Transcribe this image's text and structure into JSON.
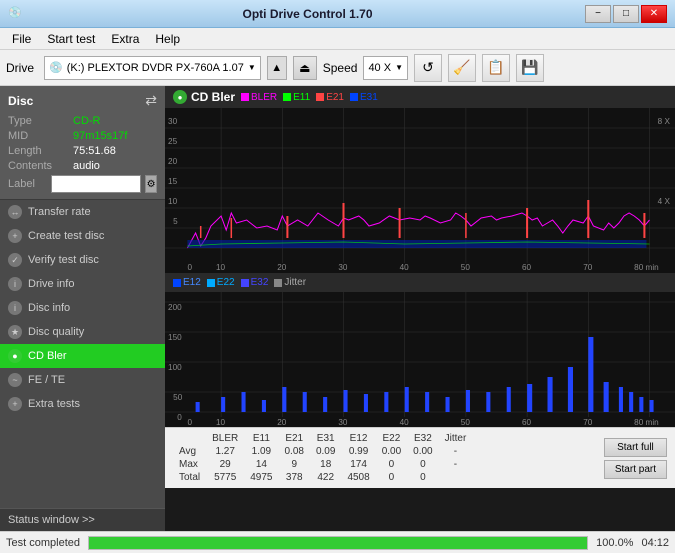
{
  "titlebar": {
    "title": "Opti Drive Control 1.70",
    "icon": "💿",
    "minimize": "−",
    "maximize": "□",
    "close": "✕"
  },
  "menubar": {
    "items": [
      "File",
      "Start test",
      "Extra",
      "Help"
    ]
  },
  "toolbar": {
    "drive_label": "Drive",
    "drive_icon": "💿",
    "drive_text": "(K:)  PLEXTOR DVDR  PX-760A 1.07",
    "speed_label": "Speed",
    "speed_value": "40 X"
  },
  "disc": {
    "title": "Disc",
    "type_label": "Type",
    "type_value": "CD-R",
    "mid_label": "MID",
    "mid_value": "97m15s17f",
    "length_label": "Length",
    "length_value": "75:51.68",
    "contents_label": "Contents",
    "contents_value": "audio",
    "label_label": "Label",
    "label_value": ""
  },
  "sidebar": {
    "items": [
      {
        "label": "Transfer rate",
        "active": false
      },
      {
        "label": "Create test disc",
        "active": false
      },
      {
        "label": "Verify test disc",
        "active": false
      },
      {
        "label": "Drive info",
        "active": false
      },
      {
        "label": "Disc info",
        "active": false
      },
      {
        "label": "Disc quality",
        "active": false
      },
      {
        "label": "CD Bler",
        "active": true
      },
      {
        "label": "FE / TE",
        "active": false
      },
      {
        "label": "Extra tests",
        "active": false
      }
    ],
    "status_window": "Status window >>"
  },
  "chart": {
    "title": "CD Bler",
    "legend_top": [
      {
        "label": "BLER",
        "color": "#ff00ff"
      },
      {
        "label": "E11",
        "color": "#00ff00"
      },
      {
        "label": "E21",
        "color": "#ff4444"
      },
      {
        "label": "E31",
        "color": "#0044ff"
      }
    ],
    "legend_bottom": [
      {
        "label": "E12",
        "color": "#0044ff"
      },
      {
        "label": "E22",
        "color": "#00aaff"
      },
      {
        "label": "E32",
        "color": "#4444ff"
      },
      {
        "label": "Jitter",
        "color": "#888888"
      }
    ],
    "y_axis_top": [
      "30",
      "25",
      "20",
      "15",
      "10",
      "5",
      "0"
    ],
    "y_axis_right_top": [
      "8 X",
      "4 X"
    ],
    "x_axis": [
      "0",
      "10",
      "20",
      "30",
      "40",
      "50",
      "60",
      "70",
      "80 min"
    ],
    "y_axis_bottom": [
      "200",
      "150",
      "100",
      "50",
      "0"
    ],
    "x_axis_bottom": [
      "0",
      "10",
      "20",
      "30",
      "40",
      "50",
      "60",
      "70",
      "80 min"
    ]
  },
  "stats": {
    "columns": [
      "BLER",
      "E11",
      "E21",
      "E31",
      "E12",
      "E22",
      "E32",
      "Jitter"
    ],
    "rows": [
      {
        "label": "Avg",
        "values": [
          "1.27",
          "1.09",
          "0.08",
          "0.09",
          "0.99",
          "0.00",
          "0.00",
          "-"
        ]
      },
      {
        "label": "Max",
        "values": [
          "29",
          "14",
          "9",
          "18",
          "174",
          "0",
          "0",
          "-"
        ]
      },
      {
        "label": "Total",
        "values": [
          "5775",
          "4975",
          "378",
          "422",
          "4508",
          "0",
          "0",
          ""
        ]
      }
    ],
    "btn_start_full": "Start full",
    "btn_start_part": "Start part"
  },
  "statusbar": {
    "status": "Test completed",
    "progress": 100,
    "progress_text": "100.0%",
    "time": "04:12"
  },
  "colors": {
    "accent_green": "#22cc22",
    "sidebar_bg": "#4a4a4a",
    "chart_bg": "#111111"
  }
}
